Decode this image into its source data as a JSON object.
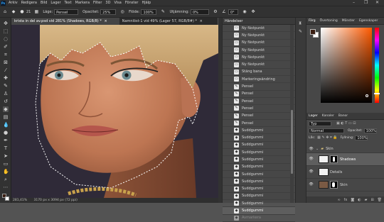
{
  "menu": {
    "logo": "Ps",
    "items": [
      "Arkiv",
      "Redigera",
      "Bild",
      "Lager",
      "Text",
      "Markera",
      "Filter",
      "3D",
      "Visa",
      "Fönster",
      "Hjälp"
    ],
    "win_minimize": "–",
    "win_restore": "❐",
    "win_close": "✕"
  },
  "options": {
    "mode_label": "Läge:",
    "mode_value": "Pensel",
    "opacity_label": "Opacitet:",
    "opacity_value": "25%",
    "flow_label": "Flöde:",
    "flow_value": "100%",
    "smoothing_label": "Utjämning:",
    "smoothing_value": "0%",
    "angle_value": "0°",
    "brush_size": "21"
  },
  "tabs": {
    "doc1": "krista in del av.psd vid 281% (Shadows, RGB/8) *",
    "doc1_close": "×",
    "doc2": "Namnlöst-1 vid 49% (Lager 57, RGB/8#) *",
    "doc2_close": "×"
  },
  "status": {
    "zoom": "281,41%",
    "size": "3170 px x 3094 px (72 ppi)"
  },
  "history": {
    "title": "Händelser",
    "rows": [
      {
        "icon": "doc",
        "label": "Ny fästpunkt"
      },
      {
        "icon": "doc",
        "label": "Ny fästpunkt"
      },
      {
        "icon": "doc",
        "label": "Ny fästpunkt"
      },
      {
        "icon": "doc",
        "label": "Ny fästpunkt"
      },
      {
        "icon": "doc",
        "label": "Ny fästpunkt"
      },
      {
        "icon": "doc",
        "label": "Ny fästpunkt"
      },
      {
        "icon": "doc",
        "label": "Stäng bana"
      },
      {
        "icon": "doc",
        "label": "Markeringsändring"
      },
      {
        "icon": "brush",
        "label": "Pensel"
      },
      {
        "icon": "brush",
        "label": "Pensel"
      },
      {
        "icon": "brush",
        "label": "Pensel"
      },
      {
        "icon": "brush",
        "label": "Pensel"
      },
      {
        "icon": "brush",
        "label": "Pensel"
      },
      {
        "icon": "brush",
        "label": "Pensel"
      },
      {
        "icon": "smudge",
        "label": "Suddgummi"
      },
      {
        "icon": "smudge",
        "label": "Suddgummi"
      },
      {
        "icon": "smudge",
        "label": "Suddgummi"
      },
      {
        "icon": "smudge",
        "label": "Suddgummi"
      },
      {
        "icon": "smudge",
        "label": "Suddgummi"
      },
      {
        "icon": "smudge",
        "label": "Suddgummi"
      },
      {
        "icon": "smudge",
        "label": "Suddgummi"
      },
      {
        "icon": "smudge",
        "label": "Suddgummi"
      },
      {
        "icon": "smudge",
        "label": "Suddgummi"
      },
      {
        "icon": "smudge",
        "label": "Suddgummi"
      },
      {
        "icon": "smudge",
        "label": "Suddgummi"
      },
      {
        "icon": "smudge",
        "label": "Suddgummi"
      },
      {
        "icon": "smudge",
        "label": "Avmarkera"
      }
    ],
    "selected_index": 25,
    "dimmed_index": 26
  },
  "color_panel": {
    "tabs": [
      "Färg",
      "Övertoning",
      "Mönster",
      "Egenskaper"
    ],
    "foreground": "#3a1e12",
    "background": "#ffffff",
    "hue_color": "#ff5a00"
  },
  "layers_panel": {
    "tabs": [
      "Lager",
      "Kanaler",
      "Banor"
    ],
    "filter_label": "Typ",
    "blend_mode": "Normal",
    "opacity_label": "Opacitet:",
    "opacity_value": "100%",
    "lock_label": "Lås:",
    "fill_label": "Fyllning:",
    "fill_value": "100%",
    "layers": [
      {
        "name": "Skin",
        "kind": "group"
      },
      {
        "name": "Shadows",
        "kind": "layer"
      },
      {
        "name": "Details",
        "kind": "layer"
      },
      {
        "name": "Skin",
        "kind": "image"
      }
    ]
  },
  "colors": {
    "accent": "#31a8ff",
    "panel_bg": "#474747",
    "dark_bg": "#323232",
    "selection": "#5e5e5e"
  }
}
